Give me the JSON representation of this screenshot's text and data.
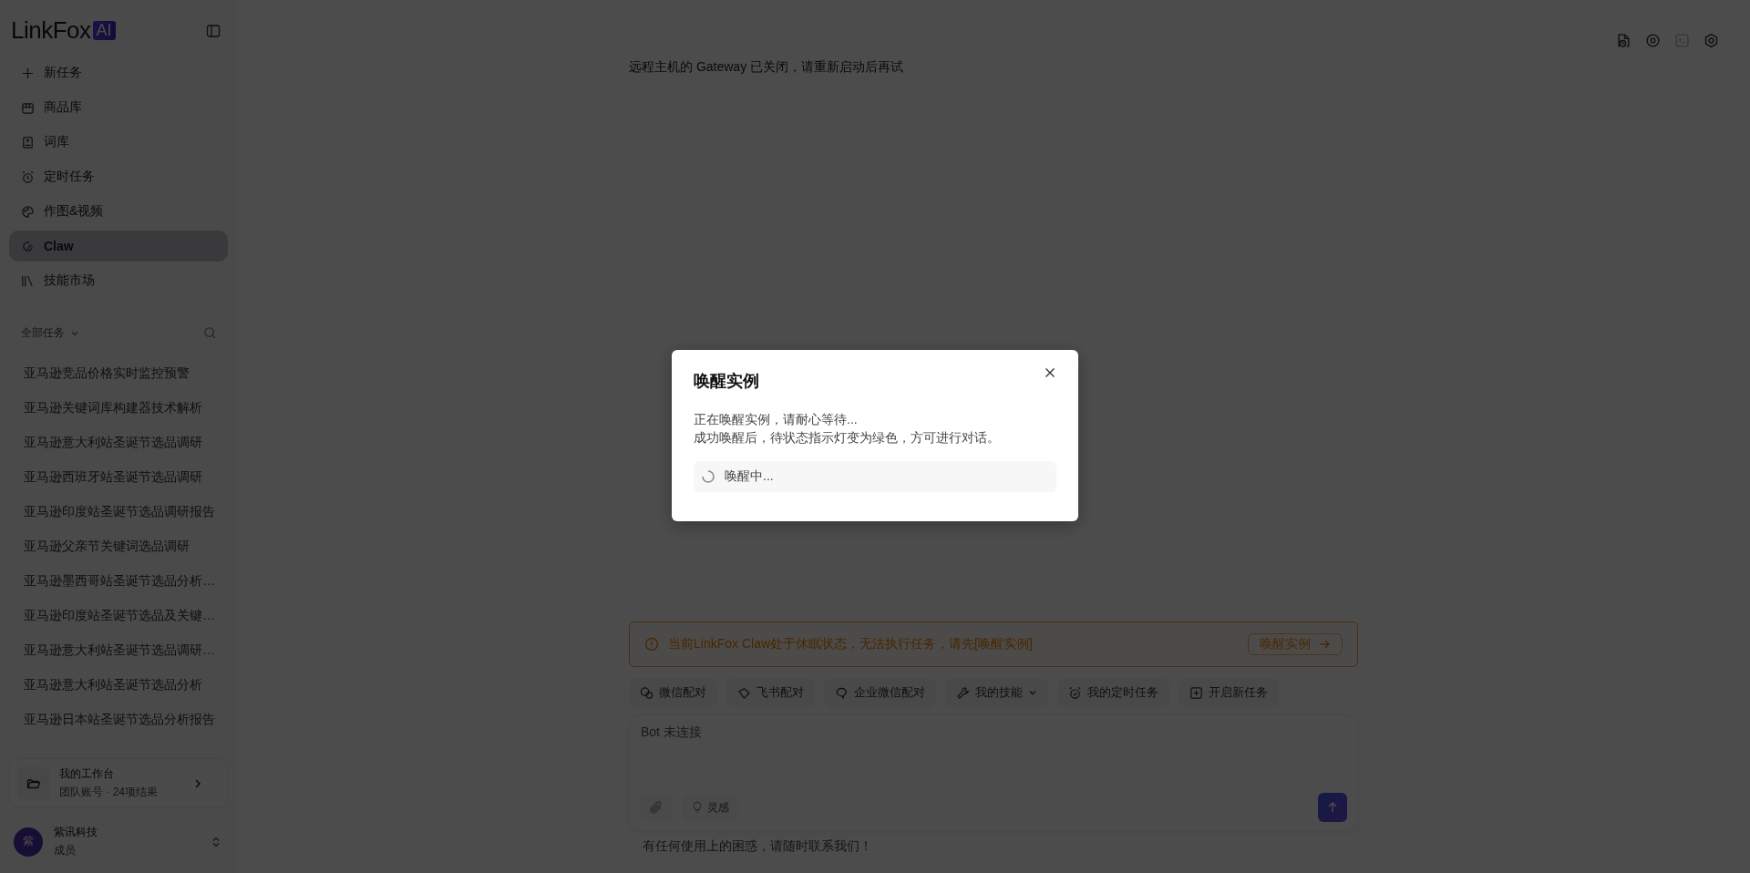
{
  "sidebar": {
    "logo": {
      "text": "LinkFox",
      "badge": "AI"
    },
    "nav": [
      {
        "label": "新任务",
        "selected": false
      },
      {
        "label": "商品库",
        "selected": false
      },
      {
        "label": "词库",
        "selected": false
      },
      {
        "label": "定时任务",
        "selected": false
      },
      {
        "label": "作图&视频",
        "selected": false
      },
      {
        "label": "Claw",
        "selected": true
      },
      {
        "label": "技能市场",
        "selected": false
      }
    ],
    "task_filter": "全部任务",
    "tasks": [
      "亚马逊竞品价格实时监控预警",
      "亚马逊关键词库构建器技术解析",
      "亚马逊意大利站圣诞节选品调研",
      "亚马逊西班牙站圣诞节选品调研",
      "亚马逊印度站圣诞节选品调研报告",
      "亚马逊父亲节关键词选品调研",
      "亚马逊墨西哥站圣诞节选品分析…",
      "亚马逊印度站圣诞节选品及关键…",
      "亚马逊意大利站圣诞节选品调研…",
      "亚马逊意大利站圣诞节选品分析",
      "亚马逊日本站圣诞节选品分析报告"
    ],
    "workspace": {
      "title": "我的工作台",
      "subtitle": "团队账号 · 24项结果"
    },
    "user": {
      "avatar": "紫",
      "name": "紫讯科技",
      "role": "成员"
    }
  },
  "header_actions": [
    {
      "disabled": false
    },
    {
      "disabled": false
    },
    {
      "disabled": true
    },
    {
      "disabled": false
    }
  ],
  "main": {
    "message": "远程主机的 Gateway 已关闭，请重新启动后再试",
    "banner": {
      "text": "当前LinkFox Claw处于休眠状态，无法执行任务，请先[唤醒实例]",
      "button": "唤醒实例"
    },
    "toolbar": [
      {
        "label": "微信配对",
        "dropdown": false
      },
      {
        "label": "飞书配对",
        "dropdown": false
      },
      {
        "label": "企业微信配对",
        "dropdown": false
      },
      {
        "label": "我的技能",
        "dropdown": true
      },
      {
        "label": "我的定时任务",
        "dropdown": false
      },
      {
        "label": "开启新任务",
        "dropdown": false
      }
    ],
    "input": {
      "placeholder": "Bot 未连接",
      "inspiration": "灵感"
    },
    "footer": "有任何使用上的困惑，请随时联系我们！"
  },
  "modal": {
    "title": "唤醒实例",
    "lines": [
      "正在唤醒实例，请耐心等待...",
      "成功唤醒后，待状态指示灯变为绿色，方可进行对话。"
    ],
    "status": "唤醒中..."
  }
}
